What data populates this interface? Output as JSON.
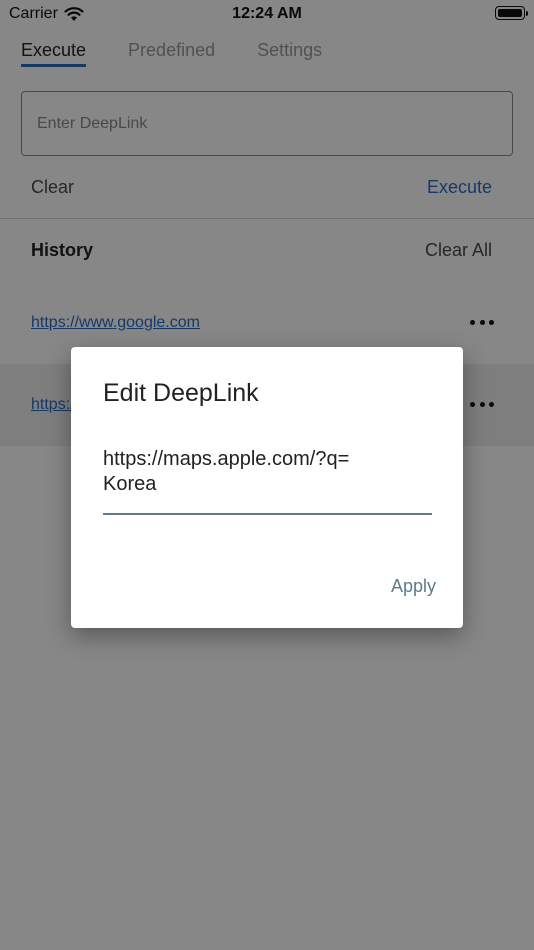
{
  "status_bar": {
    "carrier": "Carrier",
    "time": "12:24 AM"
  },
  "tabs": [
    {
      "label": "Execute",
      "active": true
    },
    {
      "label": "Predefined",
      "active": false
    },
    {
      "label": "Settings",
      "active": false
    }
  ],
  "deeplink_input": {
    "placeholder": "Enter DeepLink",
    "value": ""
  },
  "actions": {
    "clear_label": "Clear",
    "execute_label": "Execute"
  },
  "history": {
    "title": "History",
    "clear_all_label": "Clear All",
    "items": [
      {
        "url": "https://www.google.com"
      },
      {
        "url": "https://maps.apple.com/?q=Korea"
      }
    ]
  },
  "dialog": {
    "title": "Edit DeepLink",
    "value": "https://maps.apple.com/?q=\nKorea",
    "apply_label": "Apply"
  },
  "colors": {
    "accent": "#2a6cc4",
    "dialog_accent": "#5e7a8c"
  },
  "icons": {
    "wifi": "wifi-icon",
    "battery": "battery-icon",
    "more": "more-horizontal-icon"
  }
}
